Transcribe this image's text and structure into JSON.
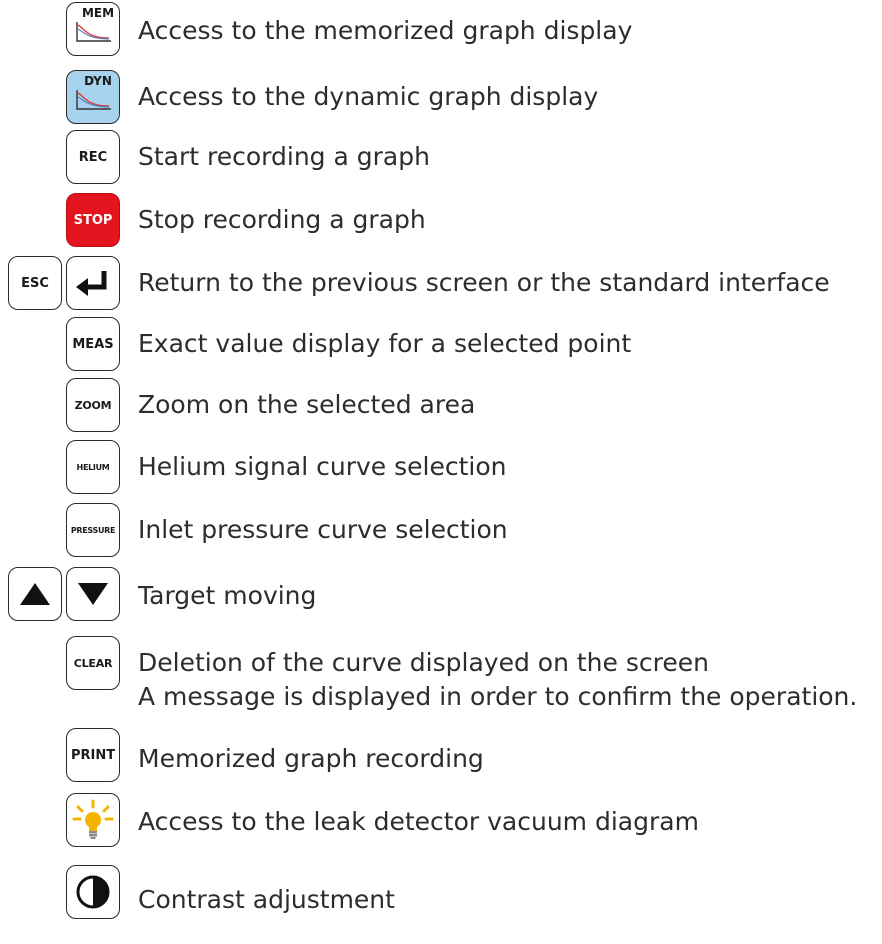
{
  "rows": [
    {
      "key": "MEM",
      "icon": "graph-curve-icon",
      "desc": "Access to the memorized graph display"
    },
    {
      "key": "DYN",
      "icon": "graph-curve-icon",
      "desc": "Access to the dynamic graph display"
    },
    {
      "key": "REC",
      "desc": "Start recording a graph"
    },
    {
      "key": "STOP",
      "desc": "Stop recording a graph"
    },
    {
      "key": "ESC",
      "key2_icon": "enter-arrow-icon",
      "desc": "Return to the previous screen or the standard interface"
    },
    {
      "key": "MEAS",
      "desc": "Exact value display for a selected point"
    },
    {
      "key": "ZOOM",
      "desc": "Zoom on the selected area"
    },
    {
      "key": "HELIUM",
      "desc": "Helium signal curve selection"
    },
    {
      "key": "PRESSURE",
      "desc": "Inlet pressure curve selection"
    },
    {
      "key_icon": "triangle-up-icon",
      "key2_icon": "triangle-down-icon",
      "desc": "Target moving"
    },
    {
      "key": "CLEAR",
      "desc": "Deletion of the curve displayed on the screen",
      "desc2": "A message is displayed in order to confirm the operation."
    },
    {
      "key": "PRINT",
      "desc": "Memorized graph recording"
    },
    {
      "key_icon": "light-bulb-icon",
      "desc": "Access to the leak detector vacuum diagram"
    },
    {
      "key_icon": "contrast-icon",
      "desc": "Contrast adjustment"
    }
  ],
  "colors": {
    "dyn_key_bg": "#a8d3ee",
    "stop_key_bg": "#e3141e",
    "bulb_yellow": "#f5b400",
    "text": "#2d2d2d"
  }
}
